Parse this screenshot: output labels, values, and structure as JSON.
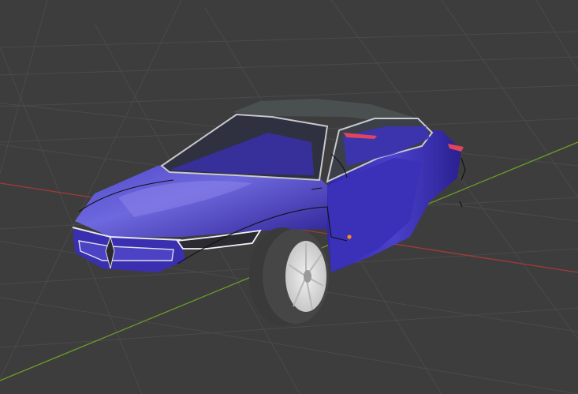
{
  "viewport": {
    "background_color": "#3d3d3d",
    "grid_color": "#4a4a4a",
    "x_axis_color": "#a33a3a",
    "y_axis_color": "#6a9a2a"
  },
  "car": {
    "body_color": "#3a2fb0",
    "body_highlight_color": "#6a62e0",
    "glass_color": "#2a2a32",
    "roof_color": "#4a5050",
    "trim_color": "#d8d8e0",
    "tail_light_color": "#e0455a",
    "tire_color": "#3a3a3a",
    "rim_color": "#d6d6d6",
    "selection_wire_color": "#111111",
    "origin_point_color": "#ff8a1a"
  }
}
